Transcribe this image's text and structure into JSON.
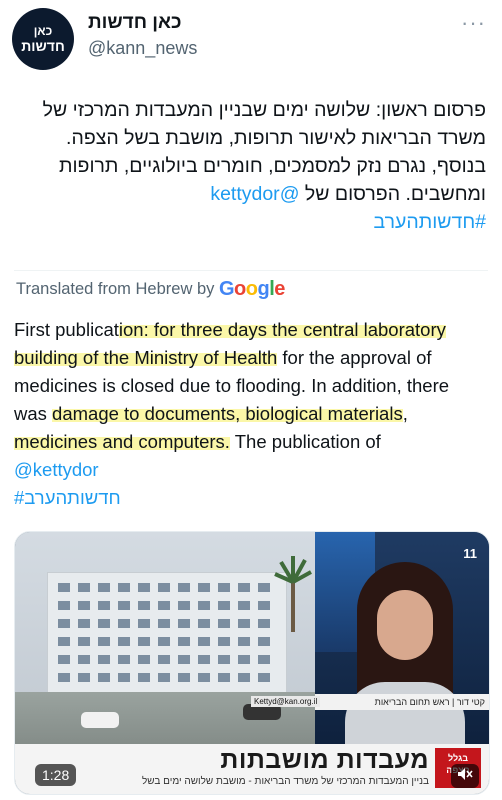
{
  "account": {
    "avatar_line1": "כאן",
    "avatar_line2": "חדשות",
    "display_name": "כאן חדשות",
    "handle": "@kann_news",
    "more_icon": "more-horizontal-icon"
  },
  "tweet": {
    "hebrew_lines": [
      "פרסום ראשון: שלושה ימים שבניין המעבדות המרכזי של",
      "משרד הבריאות לאישור תרופות, מושבת בשל הצפה.",
      "בנוסף, נגרם נזק למסמכים, חומרים ביולוגיים, תרופות",
      "ומחשבים. הפרסום של"
    ],
    "hebrew_mention": "@kettydor",
    "hebrew_hashtag": "#חדשותהערב",
    "translated_label": "Translated from Hebrew by",
    "google_letters": [
      "G",
      "o",
      "o",
      "g",
      "l",
      "e"
    ],
    "english_lines": [
      {
        "plain": "First publicat",
        "hl": "ion: for three days the central laboratory"
      },
      {
        "plain": "",
        "hl": "building of the Ministry of Health",
        "tail": " for the approval of"
      },
      {
        "plain": "medicines is closed due to flooding. In addition, there"
      },
      {
        "plain": "was ",
        "hl": "damage to documents, biological materials",
        "tail": ","
      },
      {
        "plain": "",
        "hl": "medicines and computers.",
        "tail": " The publication of"
      }
    ],
    "english_mention": "@kettydor",
    "english_hashtag": "#חדשותהערב",
    "highlight_color": "#fbf7a8"
  },
  "video": {
    "lower_third_title": "מעבדות מושבתות",
    "lower_third_subtitle": "בניין המעבדות המרכזי של משרד הבריאות - מושבת שלושה ימים בשל",
    "reporter_caption": "קטי דור | ראש תחום הבריאות",
    "reporter_email": "Kettyd@kan.org.il",
    "logo_line1": "בגלל",
    "logo_line2": "הצפה",
    "channel_mark": "11",
    "timer": "1:28",
    "mute_icon": "speaker-muted-icon"
  },
  "colors": {
    "link": "#1d9bf0",
    "muted_text": "#536471"
  }
}
